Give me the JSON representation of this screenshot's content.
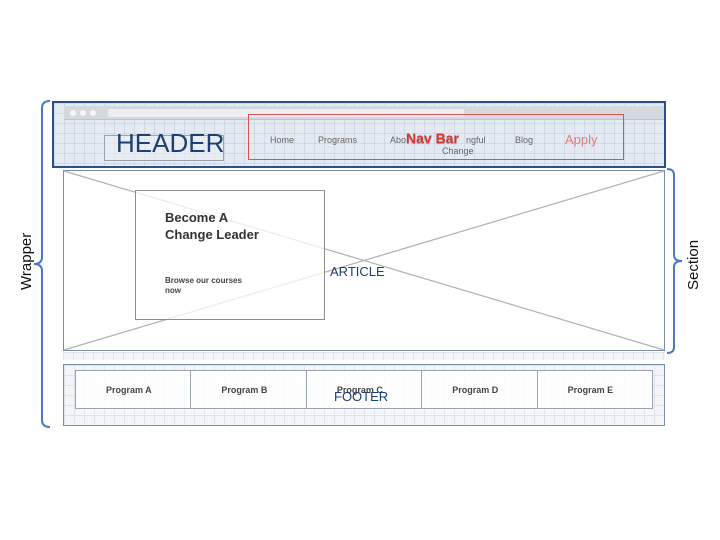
{
  "labels": {
    "header": "HEADER",
    "nav_bar": "Nav Bar",
    "article": "ARTICLE",
    "footer": "FOOTER",
    "wrapper": "Wrapper",
    "section": "Section"
  },
  "nav": {
    "home": "Home",
    "programs": "Programs",
    "about": "Abo",
    "meaningful_change_line1": "ngful",
    "meaningful_change_line2": "Change",
    "blog": "Blog",
    "apply": "Apply"
  },
  "hero": {
    "title_line1": "Become A",
    "title_line2": "Change Leader",
    "subtitle_line1": "Browse our courses",
    "subtitle_line2": "now"
  },
  "programs": [
    "Program A",
    "Program B",
    "Program C",
    "Program D",
    "Program E"
  ],
  "colors": {
    "header_border": "#2c4f86",
    "label_blue": "#1d3f72",
    "nav_red": "#d9534f",
    "apply": "#e07b76"
  }
}
